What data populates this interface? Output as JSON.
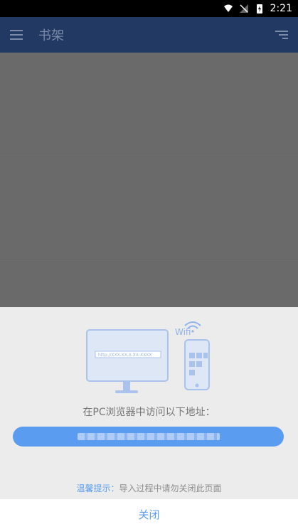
{
  "status_bar": {
    "time": "2:21"
  },
  "toolbar": {
    "title": "书架"
  },
  "sheet": {
    "instruction": "在PC浏览器中访问以下地址：",
    "address_placeholder": "http://XXX.XX.X.XX:XXXX",
    "wifi_label": "Wifi",
    "tip_label": "温馨提示：",
    "tip_text": "导入过程中请勿关闭此页面",
    "close_label": "关闭"
  },
  "colors": {
    "accent": "#5a9cf0",
    "toolbar": "#223a63",
    "overlay": "#6a6a6a",
    "sheet_bg": "#ececec"
  }
}
